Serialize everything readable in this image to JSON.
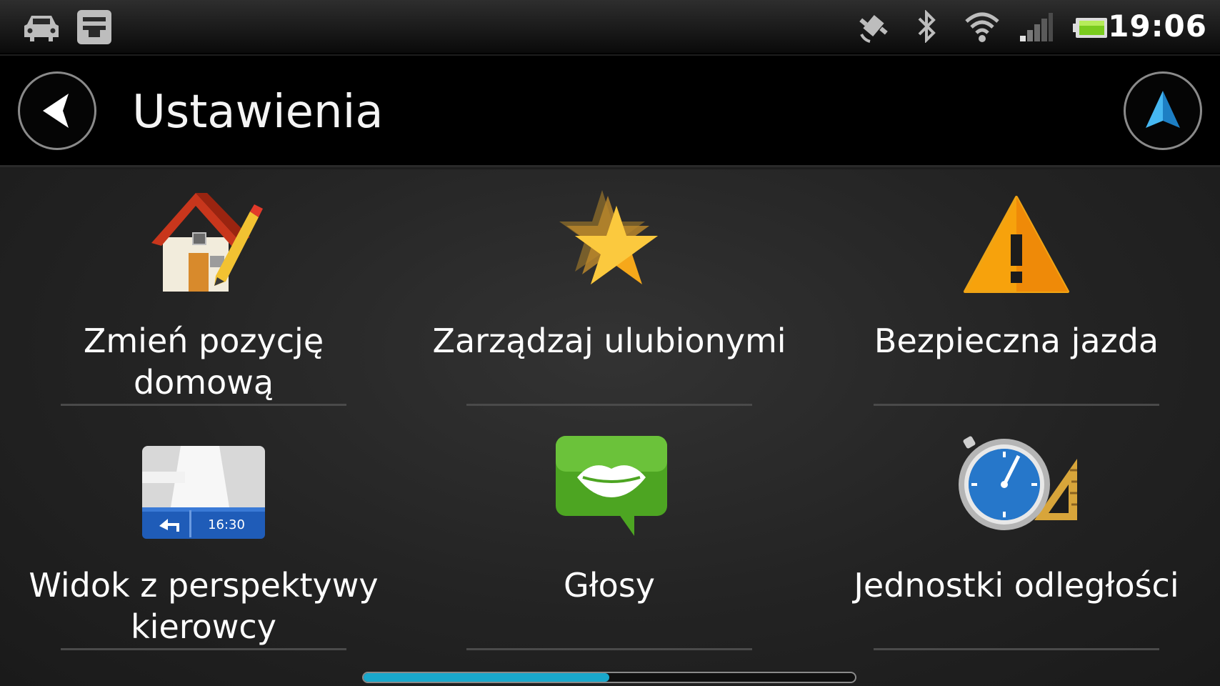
{
  "status_bar": {
    "time": "19:06",
    "left_icons": [
      "car-icon",
      "sim-toolkit-icon"
    ],
    "right_icons": [
      "gps-icon",
      "bluetooth-icon",
      "wifi-icon",
      "signal-icon",
      "battery-icon"
    ],
    "battery_level": 0.9
  },
  "header": {
    "title": "Ustawienia",
    "back_icon": "back-arrow-icon",
    "nav_icon": "navigation-arrow-icon",
    "accent_color": "#2ea3e6"
  },
  "settings": [
    {
      "label_line1": "Zmień pozycję",
      "label_line2": "domową",
      "icon": "home-edit-icon"
    },
    {
      "label_line1": "Zarządzaj ulubionymi",
      "label_line2": "",
      "icon": "favorites-star-icon"
    },
    {
      "label_line1": "Bezpieczna jazda",
      "label_line2": "",
      "icon": "warning-icon"
    },
    {
      "label_line1": "Widok z perspektywy",
      "label_line2": "kierowcy",
      "icon": "driver-view-icon",
      "icon_time": "16:30"
    },
    {
      "label_line1": "Głosy",
      "label_line2": "",
      "icon": "voices-icon"
    },
    {
      "label_line1": "Jednostki odległości",
      "label_line2": "",
      "icon": "distance-units-icon"
    }
  ],
  "pager": {
    "position": 0.5,
    "color": "#1aa8cc"
  }
}
